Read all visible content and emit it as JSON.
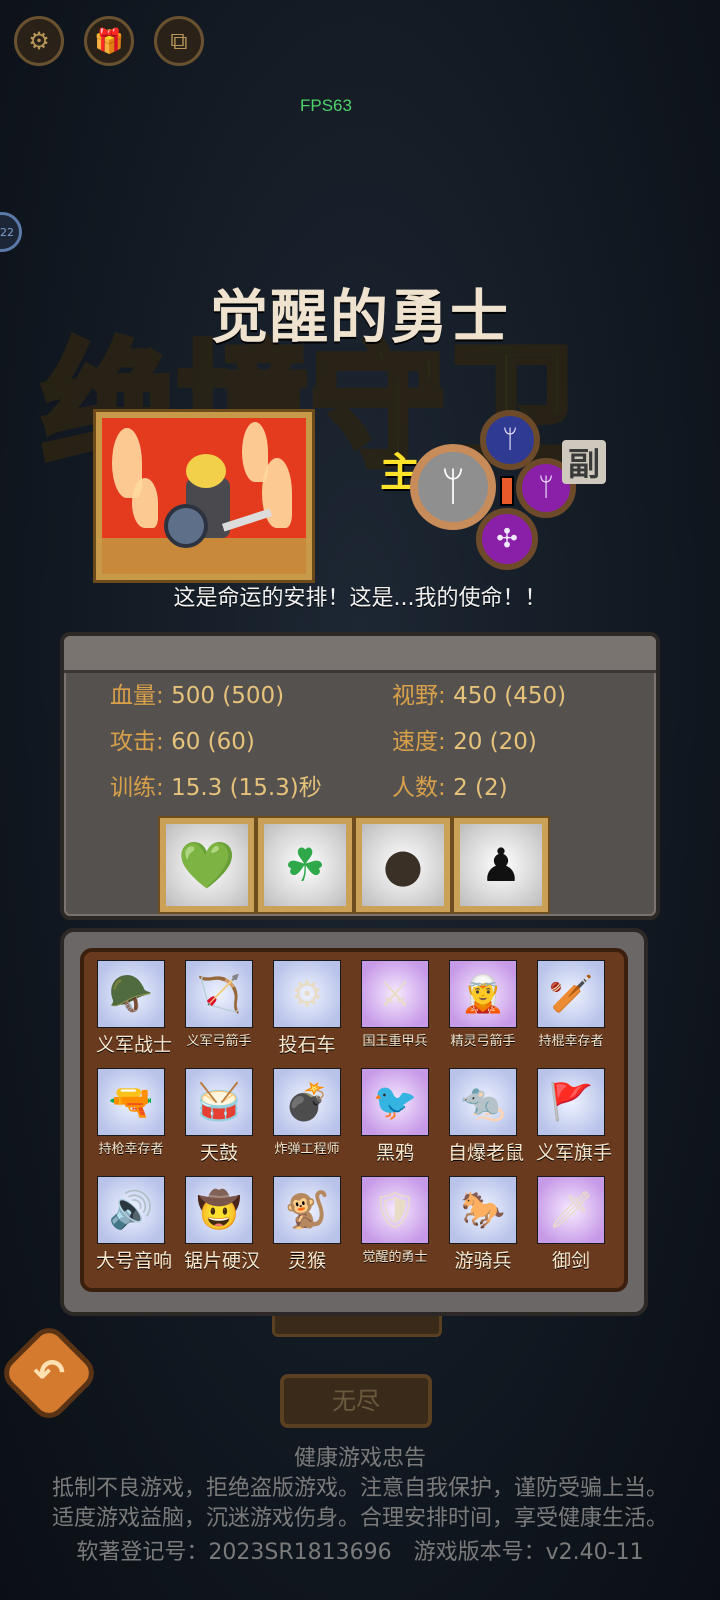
{
  "fps": "FPS63",
  "bubble": "22",
  "bg_logo": "绝境守卫",
  "hero": {
    "name": "觉醒的勇士",
    "quote": "这是命运的安排！这是...我的使命！！",
    "main_label": "主",
    "sub_label": "副"
  },
  "stats": [
    {
      "label": "血量:",
      "value": "500 (500)"
    },
    {
      "label": "视野:",
      "value": "450 (450)"
    },
    {
      "label": "攻击:",
      "value": "60 (60)"
    },
    {
      "label": "速度:",
      "value": "20 (20)"
    },
    {
      "label": "训练:",
      "value": "15.3 (15.3)秒"
    },
    {
      "label": "人数:",
      "value": "2 (2)"
    }
  ],
  "skills": [
    "heart-plus-icon",
    "clover-icon",
    "dark-orb-icon",
    "silhouette-icon"
  ],
  "units": [
    {
      "name": "义军战士"
    },
    {
      "name": "义军弓箭手"
    },
    {
      "name": "投石车"
    },
    {
      "name": "国王重甲兵"
    },
    {
      "name": "精灵弓箭手"
    },
    {
      "name": "持棍幸存者"
    },
    {
      "name": "持枪幸存者"
    },
    {
      "name": "天鼓"
    },
    {
      "name": "炸弹工程师"
    },
    {
      "name": "黑鸦"
    },
    {
      "name": "自爆老鼠"
    },
    {
      "name": "义军旗手"
    },
    {
      "name": "大号音响"
    },
    {
      "name": "锯片硬汉"
    },
    {
      "name": "灵猴"
    },
    {
      "name": "觉醒的勇士"
    },
    {
      "name": "游骑兵"
    },
    {
      "name": "御剑"
    }
  ],
  "mode_button": "无尽",
  "notice": {
    "title": "健康游戏忠告",
    "line1": "抵制不良游戏，拒绝盗版游戏。注意自我保护，谨防受骗上当。",
    "line2": "适度游戏益脑，沉迷游戏伤身。合理安排时间，享受健康生活。",
    "line3": "软著登记号：2023SR1813696　游戏版本号：v2.40-11"
  }
}
